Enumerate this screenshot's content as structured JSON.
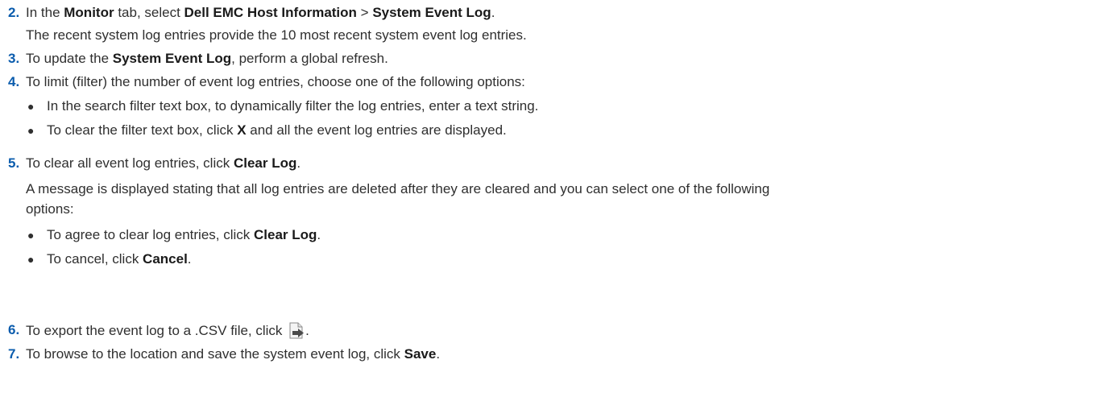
{
  "steps": [
    {
      "num": "2.",
      "pre": "In the ",
      "b1": "Monitor",
      "mid1": " tab, select ",
      "b2": "Dell EMC Host Information",
      "mid2": " > ",
      "b3": "System Event Log",
      "post": ".",
      "note": "The recent system log entries provide the 10 most recent system event log entries."
    },
    {
      "num": "3.",
      "pre": "To update the ",
      "b1": "System Event Log",
      "post": ", perform a global refresh."
    },
    {
      "num": "4.",
      "text": "To limit (filter) the number of event log entries, choose one of the following options:",
      "bullets": [
        {
          "text": "In the search filter text box, to dynamically filter the log entries, enter a text string."
        },
        {
          "pre": "To clear the filter text box, click ",
          "b": "X",
          "post": " and all the event log entries are displayed."
        }
      ]
    },
    {
      "num": "5.",
      "pre": "To clear all event log entries, click ",
      "b1": "Clear Log",
      "post": ".",
      "note1": "A message is displayed stating that all log entries are deleted after they are cleared and you can select one of the following",
      "note2": "options:",
      "bullets": [
        {
          "pre": "To agree to clear log entries, click ",
          "b": "Clear Log",
          "post": "."
        },
        {
          "pre": "To cancel, click ",
          "b": "Cancel",
          "post": "."
        }
      ]
    },
    {
      "num": "6.",
      "pre": "To export the event log to a .CSV file, click ",
      "icon": "export-file-icon",
      "post": "."
    },
    {
      "num": "7.",
      "pre": "To browse to the location and save the system event log, click ",
      "b1": "Save",
      "post": "."
    }
  ],
  "bullet_glyph": "●",
  "colors": {
    "step_number": "#0b5cad",
    "text": "#2f2f2f"
  }
}
